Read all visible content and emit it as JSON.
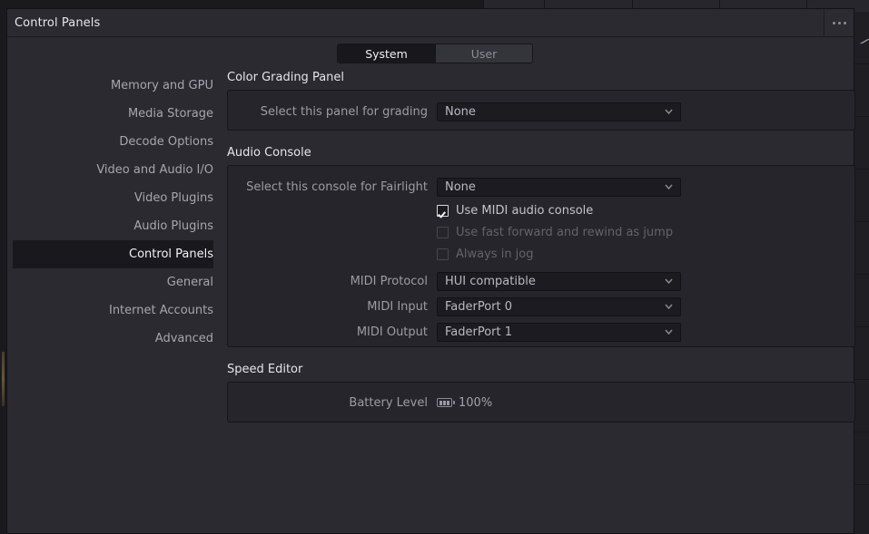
{
  "window": {
    "title": "Control Panels",
    "more_icon": "ellipsis-icon"
  },
  "tabs": [
    {
      "label": "System",
      "active": true
    },
    {
      "label": "User",
      "active": false
    }
  ],
  "sidebar": {
    "items": [
      {
        "label": "Memory and GPU",
        "selected": false
      },
      {
        "label": "Media Storage",
        "selected": false
      },
      {
        "label": "Decode Options",
        "selected": false
      },
      {
        "label": "Video and Audio I/O",
        "selected": false
      },
      {
        "label": "Video Plugins",
        "selected": false
      },
      {
        "label": "Audio Plugins",
        "selected": false
      },
      {
        "label": "Control Panels",
        "selected": true
      },
      {
        "label": "General",
        "selected": false
      },
      {
        "label": "Internet Accounts",
        "selected": false
      },
      {
        "label": "Advanced",
        "selected": false
      }
    ]
  },
  "groups": {
    "color_grading": {
      "title": "Color Grading Panel",
      "rows": [
        {
          "label": "Select this panel for grading",
          "value": "None",
          "icon": "chevron-down-icon"
        }
      ]
    },
    "audio_console": {
      "title": "Audio Console",
      "select_row": {
        "label": "Select this console for Fairlight",
        "value": "None",
        "icon": "chevron-down-icon"
      },
      "checkboxes": [
        {
          "label": "Use MIDI audio console",
          "checked": true,
          "disabled": false
        },
        {
          "label": "Use fast forward and rewind as jump",
          "checked": false,
          "disabled": true
        },
        {
          "label": "Always in jog",
          "checked": false,
          "disabled": true
        }
      ],
      "rows": [
        {
          "label": "MIDI Protocol",
          "value": "HUI compatible",
          "icon": "chevron-down-icon"
        },
        {
          "label": "MIDI Input",
          "value": "FaderPort 0",
          "icon": "chevron-down-icon"
        },
        {
          "label": "MIDI Output",
          "value": "FaderPort 1",
          "icon": "chevron-down-icon"
        }
      ]
    },
    "speed_editor": {
      "title": "Speed Editor",
      "battery": {
        "label": "Battery Level",
        "icon": "battery-full-icon",
        "value": "100%"
      }
    }
  },
  "colors": {
    "window_bg": "#2a2a30",
    "panel_bg": "#25252b",
    "field_bg": "#1b1b20",
    "selected_bg": "#19191d",
    "text_primary": "#e7e7ea",
    "text_secondary": "#9c9ca4",
    "text_disabled": "#63636b"
  }
}
